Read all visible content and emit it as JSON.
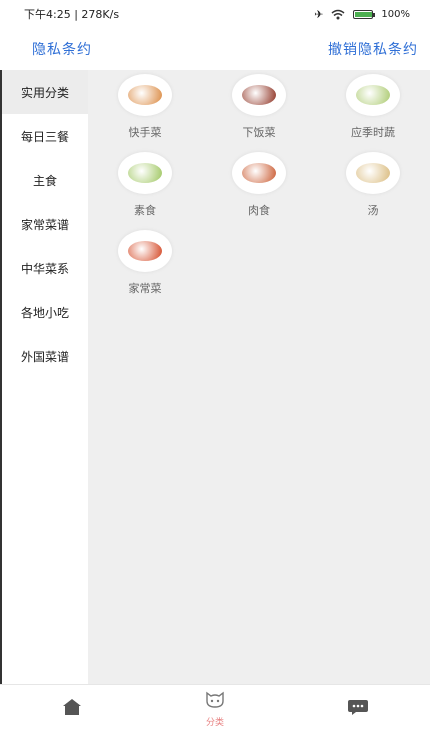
{
  "status_bar": {
    "time": "下午4:25",
    "separator": "|",
    "speed": "278K/s",
    "battery": "100%",
    "battery_level": 1.0,
    "icons": [
      "airplane-icon",
      "wifi-icon",
      "battery-icon"
    ]
  },
  "header": {
    "left_link": "隐私条约",
    "right_link": "撤销隐私条约"
  },
  "sidebar": {
    "items": [
      {
        "label": "实用分类"
      },
      {
        "label": "每日三餐"
      },
      {
        "label": "主食"
      },
      {
        "label": "家常菜谱"
      },
      {
        "label": "中华菜系"
      },
      {
        "label": "各地小吃"
      },
      {
        "label": "外国菜谱"
      }
    ],
    "active_index": 0
  },
  "categories": [
    {
      "label": "快手菜",
      "icon": "dish-quick-icon",
      "food_color": "#d9853a"
    },
    {
      "label": "下饭菜",
      "icon": "dish-rice-companion-icon",
      "food_color": "#8a2a1a"
    },
    {
      "label": "应季时蔬",
      "icon": "dish-seasonal-veg-icon",
      "food_color": "#a8c86a"
    },
    {
      "label": "素食",
      "icon": "dish-vegetarian-icon",
      "food_color": "#9bc45a"
    },
    {
      "label": "肉食",
      "icon": "dish-meat-icon",
      "food_color": "#c8552a"
    },
    {
      "label": "汤",
      "icon": "dish-soup-icon",
      "food_color": "#d8b878"
    },
    {
      "label": "家常菜",
      "icon": "dish-home-style-icon",
      "food_color": "#d2401c"
    }
  ],
  "bottom_nav": {
    "items": [
      {
        "label": "",
        "icon": "home-icon"
      },
      {
        "label": "分类",
        "icon": "category-icon"
      },
      {
        "label": "",
        "icon": "chat-icon"
      }
    ],
    "active_index": 1,
    "active_color": "#e78080",
    "icon_color": "#555555"
  },
  "colors": {
    "link": "#2f6fd6",
    "content_bg": "#efefef",
    "active_sidebar_bg": "#ececec"
  }
}
